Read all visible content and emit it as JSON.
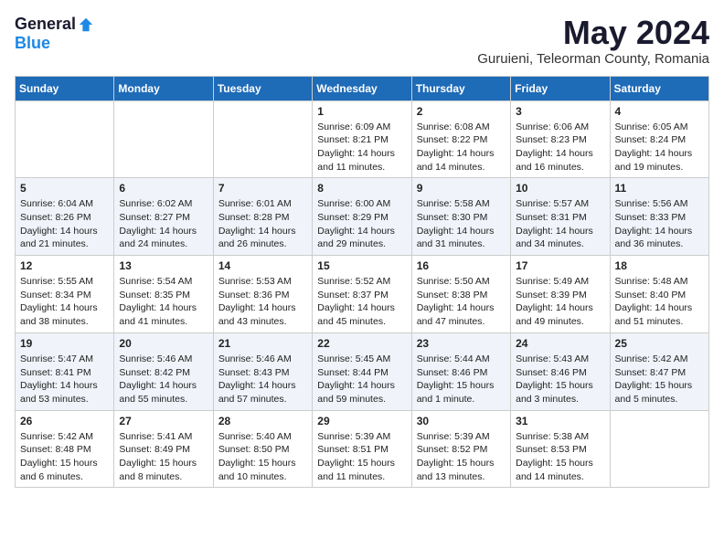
{
  "logo": {
    "general": "General",
    "blue": "Blue"
  },
  "title": "May 2024",
  "location": "Guruieni, Teleorman County, Romania",
  "weekdays": [
    "Sunday",
    "Monday",
    "Tuesday",
    "Wednesday",
    "Thursday",
    "Friday",
    "Saturday"
  ],
  "weeks": [
    [
      {
        "day": "",
        "info": ""
      },
      {
        "day": "",
        "info": ""
      },
      {
        "day": "",
        "info": ""
      },
      {
        "day": "1",
        "info": "Sunrise: 6:09 AM\nSunset: 8:21 PM\nDaylight: 14 hours\nand 11 minutes."
      },
      {
        "day": "2",
        "info": "Sunrise: 6:08 AM\nSunset: 8:22 PM\nDaylight: 14 hours\nand 14 minutes."
      },
      {
        "day": "3",
        "info": "Sunrise: 6:06 AM\nSunset: 8:23 PM\nDaylight: 14 hours\nand 16 minutes."
      },
      {
        "day": "4",
        "info": "Sunrise: 6:05 AM\nSunset: 8:24 PM\nDaylight: 14 hours\nand 19 minutes."
      }
    ],
    [
      {
        "day": "5",
        "info": "Sunrise: 6:04 AM\nSunset: 8:26 PM\nDaylight: 14 hours\nand 21 minutes."
      },
      {
        "day": "6",
        "info": "Sunrise: 6:02 AM\nSunset: 8:27 PM\nDaylight: 14 hours\nand 24 minutes."
      },
      {
        "day": "7",
        "info": "Sunrise: 6:01 AM\nSunset: 8:28 PM\nDaylight: 14 hours\nand 26 minutes."
      },
      {
        "day": "8",
        "info": "Sunrise: 6:00 AM\nSunset: 8:29 PM\nDaylight: 14 hours\nand 29 minutes."
      },
      {
        "day": "9",
        "info": "Sunrise: 5:58 AM\nSunset: 8:30 PM\nDaylight: 14 hours\nand 31 minutes."
      },
      {
        "day": "10",
        "info": "Sunrise: 5:57 AM\nSunset: 8:31 PM\nDaylight: 14 hours\nand 34 minutes."
      },
      {
        "day": "11",
        "info": "Sunrise: 5:56 AM\nSunset: 8:33 PM\nDaylight: 14 hours\nand 36 minutes."
      }
    ],
    [
      {
        "day": "12",
        "info": "Sunrise: 5:55 AM\nSunset: 8:34 PM\nDaylight: 14 hours\nand 38 minutes."
      },
      {
        "day": "13",
        "info": "Sunrise: 5:54 AM\nSunset: 8:35 PM\nDaylight: 14 hours\nand 41 minutes."
      },
      {
        "day": "14",
        "info": "Sunrise: 5:53 AM\nSunset: 8:36 PM\nDaylight: 14 hours\nand 43 minutes."
      },
      {
        "day": "15",
        "info": "Sunrise: 5:52 AM\nSunset: 8:37 PM\nDaylight: 14 hours\nand 45 minutes."
      },
      {
        "day": "16",
        "info": "Sunrise: 5:50 AM\nSunset: 8:38 PM\nDaylight: 14 hours\nand 47 minutes."
      },
      {
        "day": "17",
        "info": "Sunrise: 5:49 AM\nSunset: 8:39 PM\nDaylight: 14 hours\nand 49 minutes."
      },
      {
        "day": "18",
        "info": "Sunrise: 5:48 AM\nSunset: 8:40 PM\nDaylight: 14 hours\nand 51 minutes."
      }
    ],
    [
      {
        "day": "19",
        "info": "Sunrise: 5:47 AM\nSunset: 8:41 PM\nDaylight: 14 hours\nand 53 minutes."
      },
      {
        "day": "20",
        "info": "Sunrise: 5:46 AM\nSunset: 8:42 PM\nDaylight: 14 hours\nand 55 minutes."
      },
      {
        "day": "21",
        "info": "Sunrise: 5:46 AM\nSunset: 8:43 PM\nDaylight: 14 hours\nand 57 minutes."
      },
      {
        "day": "22",
        "info": "Sunrise: 5:45 AM\nSunset: 8:44 PM\nDaylight: 14 hours\nand 59 minutes."
      },
      {
        "day": "23",
        "info": "Sunrise: 5:44 AM\nSunset: 8:46 PM\nDaylight: 15 hours\nand 1 minute."
      },
      {
        "day": "24",
        "info": "Sunrise: 5:43 AM\nSunset: 8:46 PM\nDaylight: 15 hours\nand 3 minutes."
      },
      {
        "day": "25",
        "info": "Sunrise: 5:42 AM\nSunset: 8:47 PM\nDaylight: 15 hours\nand 5 minutes."
      }
    ],
    [
      {
        "day": "26",
        "info": "Sunrise: 5:42 AM\nSunset: 8:48 PM\nDaylight: 15 hours\nand 6 minutes."
      },
      {
        "day": "27",
        "info": "Sunrise: 5:41 AM\nSunset: 8:49 PM\nDaylight: 15 hours\nand 8 minutes."
      },
      {
        "day": "28",
        "info": "Sunrise: 5:40 AM\nSunset: 8:50 PM\nDaylight: 15 hours\nand 10 minutes."
      },
      {
        "day": "29",
        "info": "Sunrise: 5:39 AM\nSunset: 8:51 PM\nDaylight: 15 hours\nand 11 minutes."
      },
      {
        "day": "30",
        "info": "Sunrise: 5:39 AM\nSunset: 8:52 PM\nDaylight: 15 hours\nand 13 minutes."
      },
      {
        "day": "31",
        "info": "Sunrise: 5:38 AM\nSunset: 8:53 PM\nDaylight: 15 hours\nand 14 minutes."
      },
      {
        "day": "",
        "info": ""
      }
    ]
  ]
}
